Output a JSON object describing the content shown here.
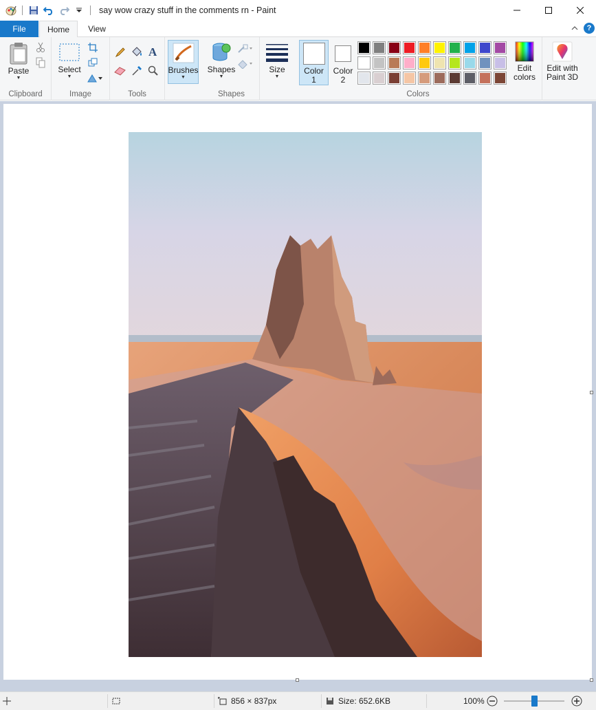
{
  "window": {
    "title": "say wow crazy stuff in the comments rn - Paint"
  },
  "tabs": {
    "file": "File",
    "home": "Home",
    "view": "View"
  },
  "ribbon": {
    "clipboard": {
      "label": "Clipboard",
      "paste": "Paste"
    },
    "image": {
      "label": "Image",
      "select": "Select"
    },
    "tools": {
      "label": "Tools"
    },
    "brushes": "Brushes",
    "shapes": {
      "label": "Shapes",
      "button": "Shapes"
    },
    "size": "Size",
    "color1": {
      "line1": "Color",
      "line2": "1",
      "value": "#ffffff"
    },
    "color2": {
      "line1": "Color",
      "line2": "2",
      "value": "#ffffff"
    },
    "colors": {
      "label": "Colors"
    },
    "edit_colors": {
      "line1": "Edit",
      "line2": "colors"
    },
    "edit_paint3d": {
      "line1": "Edit with",
      "line2": "Paint 3D"
    }
  },
  "palette": {
    "row1": [
      "#000000",
      "#7f7f7f",
      "#880015",
      "#ed1c24",
      "#ff7f27",
      "#fff200",
      "#22b14c",
      "#00a2e8",
      "#3f48cc",
      "#a349a4"
    ],
    "row2": [
      "#ffffff",
      "#c3c3c3",
      "#b97a57",
      "#ffaec9",
      "#ffc90e",
      "#efe4b0",
      "#b5e61d",
      "#99d9ea",
      "#7092be",
      "#c8bfe7"
    ],
    "row3": [
      "#e2e6ec",
      "#d9cfd1",
      "#7a3f34",
      "#f5c6a5",
      "#d59b7c",
      "#9c6b5b",
      "#5c3b33",
      "#5d5e66",
      "#c4715b",
      "#7c4636"
    ]
  },
  "status": {
    "dimensions": "856 × 837px",
    "size": "Size: 652.6KB",
    "zoom": "100%"
  }
}
